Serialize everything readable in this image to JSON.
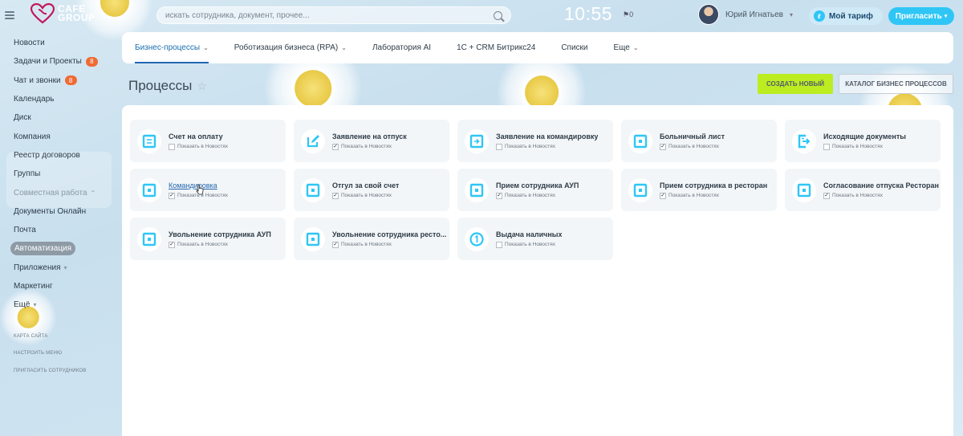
{
  "header": {
    "logo_text_1": "CAFE",
    "logo_text_2": "GROUP",
    "search_placeholder": "искать сотрудника, документ, прочее...",
    "time": "10:55",
    "notifications": "0",
    "user_name": "Юрий Игнатьев",
    "tariff_label": "Мой тариф",
    "invite_label": "Пригласить"
  },
  "sidebar": {
    "items": [
      {
        "label": "Новости"
      },
      {
        "label": "Задачи и Проекты",
        "badge": "8"
      },
      {
        "label": "Чат и звонки",
        "badge": "8"
      },
      {
        "label": "Календарь"
      },
      {
        "label": "Диск"
      },
      {
        "label": "Компания"
      },
      {
        "label": "Реестр договоров"
      },
      {
        "label": "Группы"
      },
      {
        "label": "Совместная работа"
      },
      {
        "label": "Документы Онлайн"
      },
      {
        "label": "Почта"
      },
      {
        "label": "Автоматизация"
      },
      {
        "label": "Приложения"
      },
      {
        "label": "Маркетинг"
      },
      {
        "label": "Ещё"
      }
    ],
    "footer": [
      "Карта сайта",
      "Настроить меню",
      "Пригласить сотрудников"
    ]
  },
  "tabs": [
    {
      "label": "Бизнес-процессы",
      "active": true
    },
    {
      "label": "Роботизация бизнеса (RPA)"
    },
    {
      "label": "Лаборатория AI"
    },
    {
      "label": "1С + CRM Битрикс24"
    },
    {
      "label": "Списки"
    },
    {
      "label": "Еще"
    }
  ],
  "page": {
    "title": "Процессы",
    "create_button": "Создать новый",
    "catalog_button": "Каталог бизнес процессов"
  },
  "processes": [
    {
      "title": "Счет на оплату",
      "checked": false,
      "icon": "list-icon"
    },
    {
      "title": "Заявление на отпуск",
      "checked": true,
      "icon": "edit-icon"
    },
    {
      "title": "Заявление на командировку",
      "checked": false,
      "icon": "arrow-icon"
    },
    {
      "title": "Больничный лист",
      "checked": true,
      "icon": "square-icon"
    },
    {
      "title": "Исходящие документы",
      "checked": false,
      "icon": "outgoing-icon"
    },
    {
      "title": "Командировка",
      "checked": true,
      "icon": "square-icon",
      "hovered": true
    },
    {
      "title": "Отгул за свой счет",
      "checked": true,
      "icon": "square-icon"
    },
    {
      "title": "Прием сотрудника АУП",
      "checked": true,
      "icon": "square-icon"
    },
    {
      "title": "Прием сотрудника в ресторан",
      "checked": true,
      "icon": "square-icon"
    },
    {
      "title": "Согласование отпуска Ресторан",
      "checked": true,
      "icon": "square-icon"
    },
    {
      "title": "Увольнение сотрудника АУП",
      "checked": true,
      "icon": "square-icon"
    },
    {
      "title": "Увольнение сотрудника ресто...",
      "checked": true,
      "icon": "square-icon"
    },
    {
      "title": "Выдача наличных",
      "checked": false,
      "icon": "number-one-icon"
    }
  ],
  "checkbox_label": "Показать в Новостях",
  "colors": {
    "accent": "#2fc6f6",
    "create": "#bbed21",
    "badge": "#f06a34",
    "icon": "#2fc6f6"
  }
}
